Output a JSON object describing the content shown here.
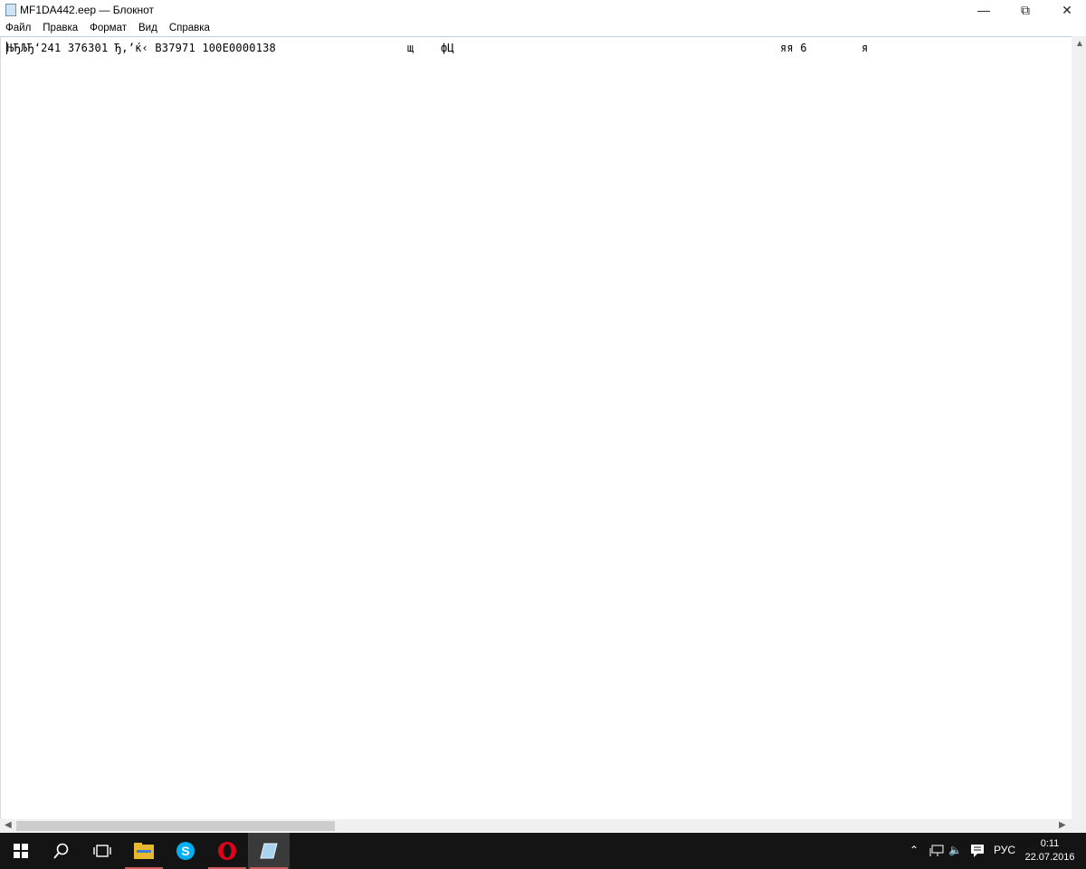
{
  "window": {
    "title": "MF1DA442.eep — Блокнот"
  },
  "menu": [
    "Файл",
    "Правка",
    "Формат",
    "Вид",
    "Справка"
  ],
  "editor": {
    "segments": [
      "ЊЂЉЂ‘241 376301 Ђ,’ќ‹ B37971 100E0000138",
      "щ",
      "фЦ",
      "яя 6",
      "я"
    ]
  },
  "taskbar": {
    "language": "РУС",
    "time": "0:11",
    "date": "22.07.2016"
  }
}
